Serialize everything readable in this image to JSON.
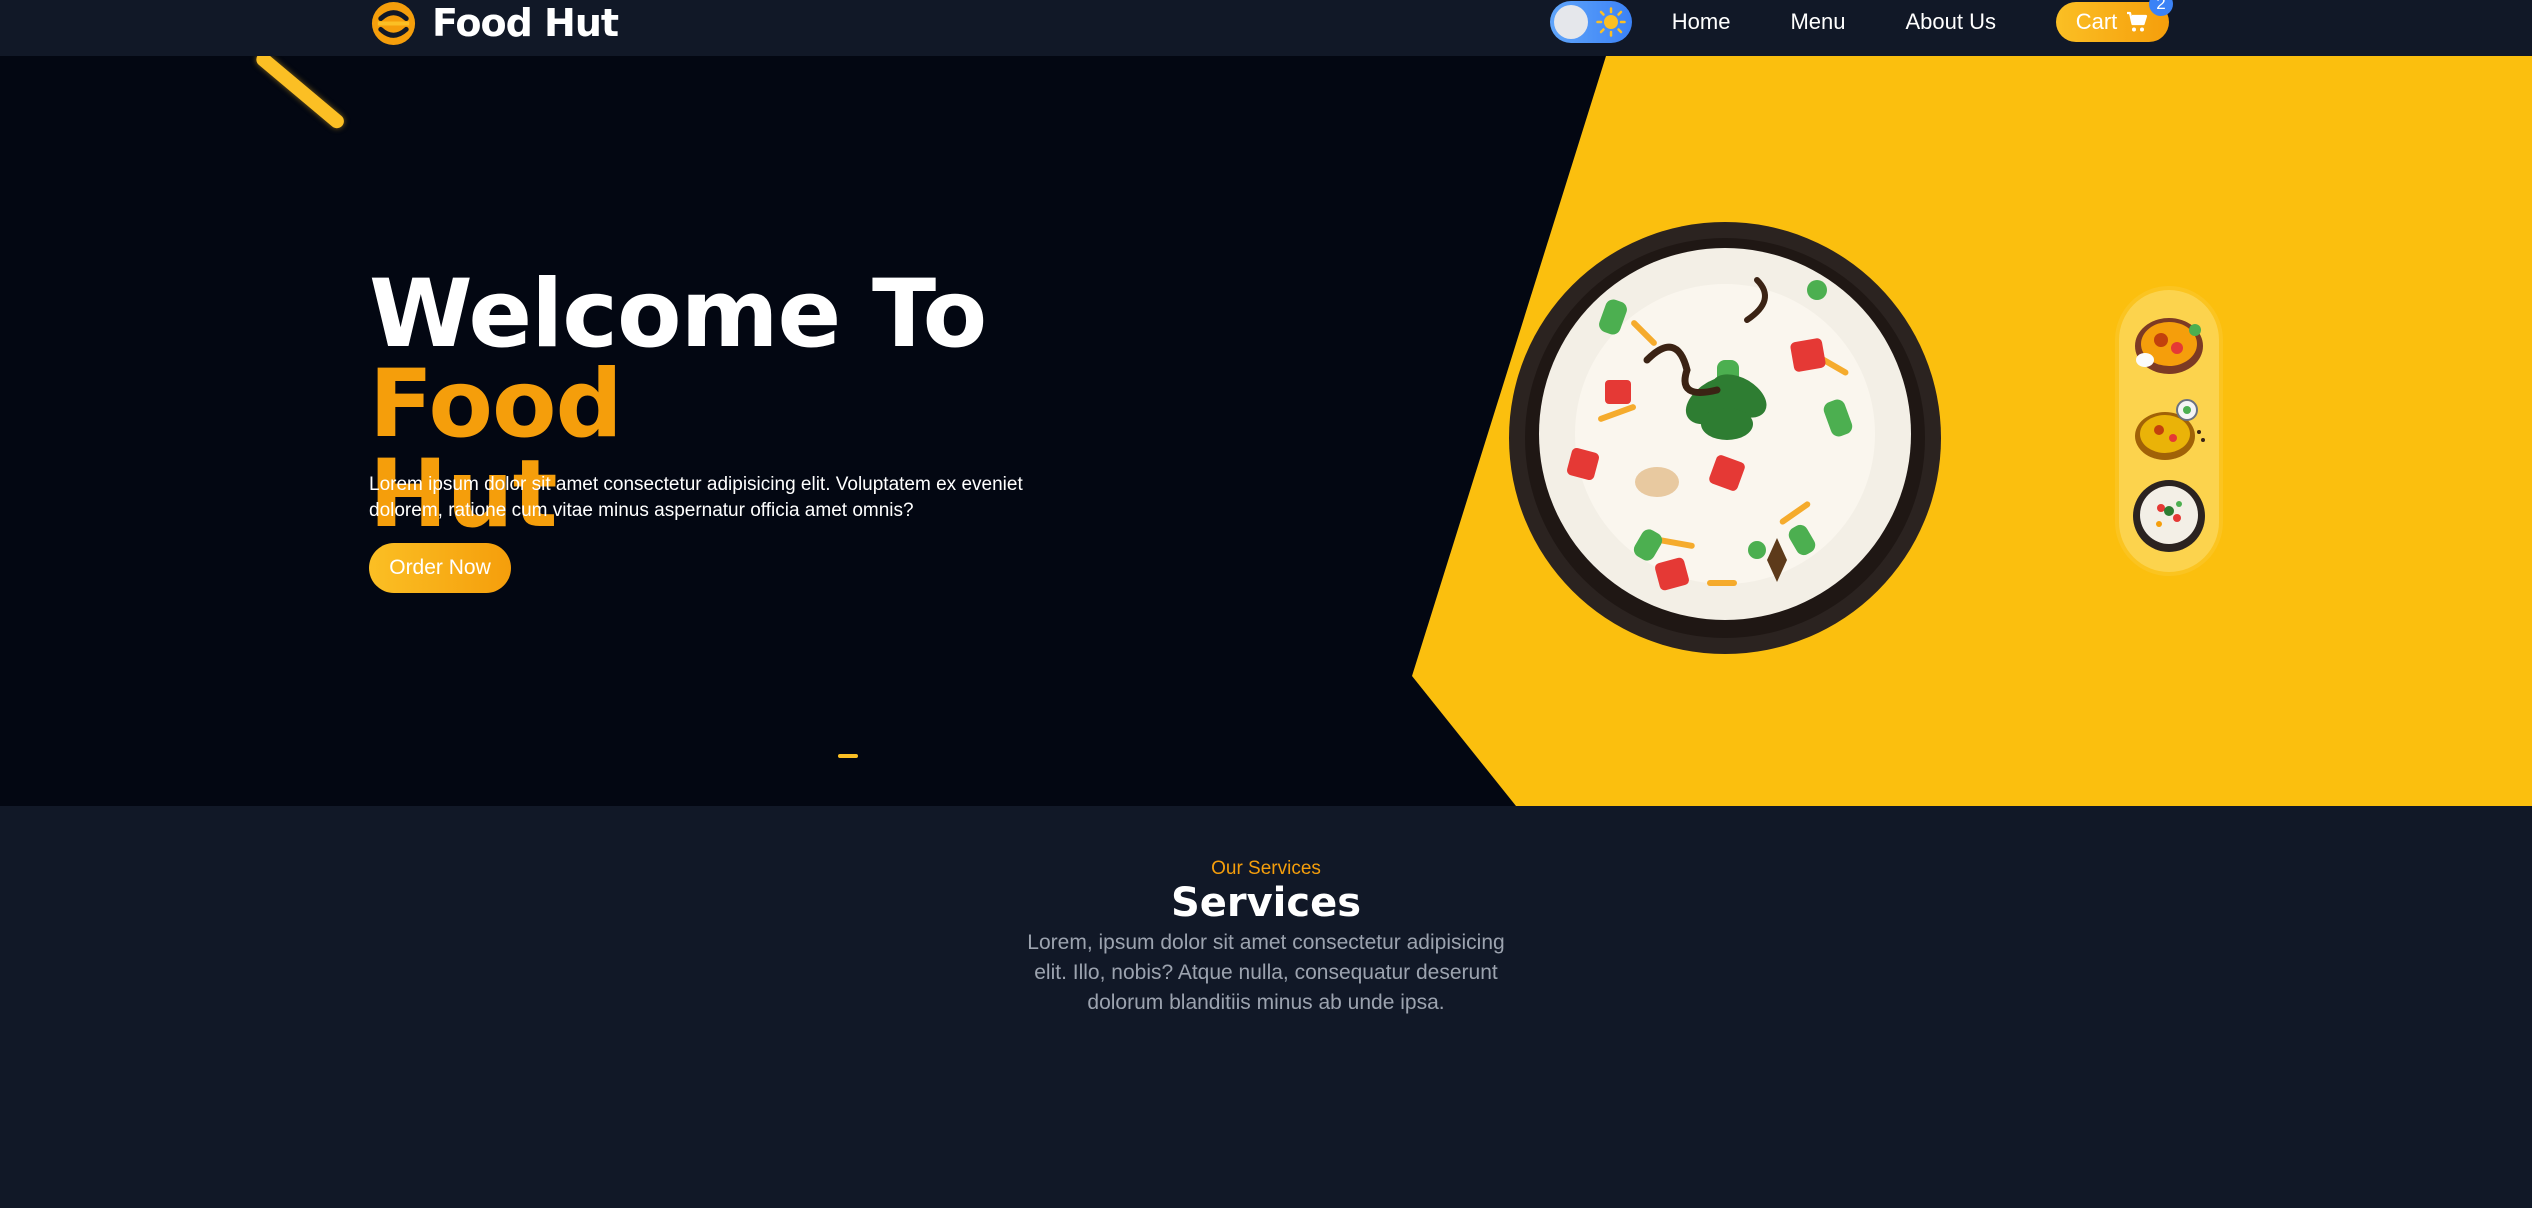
{
  "navbar": {
    "brand": "Food Hut",
    "links": [
      "Home",
      "Menu",
      "About Us"
    ],
    "cart_label": "Cart",
    "cart_count": "2",
    "theme_toggle": {
      "mode": "light",
      "icon": "sun-icon"
    }
  },
  "hero": {
    "title_part1": "Welcome To",
    "title_part2": "Food",
    "title_part3": "Hut",
    "description": "Lorem ipsum dolor sit amet consectetur adipisicing elit. Voluptatem ex eveniet dolorem, ratione cum vitae minus aspernatur officia amet omnis?",
    "order_button": "Order Now"
  },
  "dishes": {
    "main": "biryani-bowl",
    "thumbnails": [
      "biryani-plate",
      "biryani-bowl-spoon",
      "biryani-bowl"
    ]
  },
  "services": {
    "kicker": "Our Services",
    "title": "Services",
    "description": "Lorem, ipsum dolor sit amet consectetur adipisicing elit. Illo, nobis? Atque nulla, consequatur deserunt dolorum blanditiis minus ab unde ipsa."
  },
  "colors": {
    "accent": "#f59e0b",
    "accent_light": "#fbbf24",
    "hero_yellow": "#fbbf0e",
    "hero_bg": "#030712",
    "page_bg": "#111827",
    "badge_blue": "#3b82f6"
  }
}
